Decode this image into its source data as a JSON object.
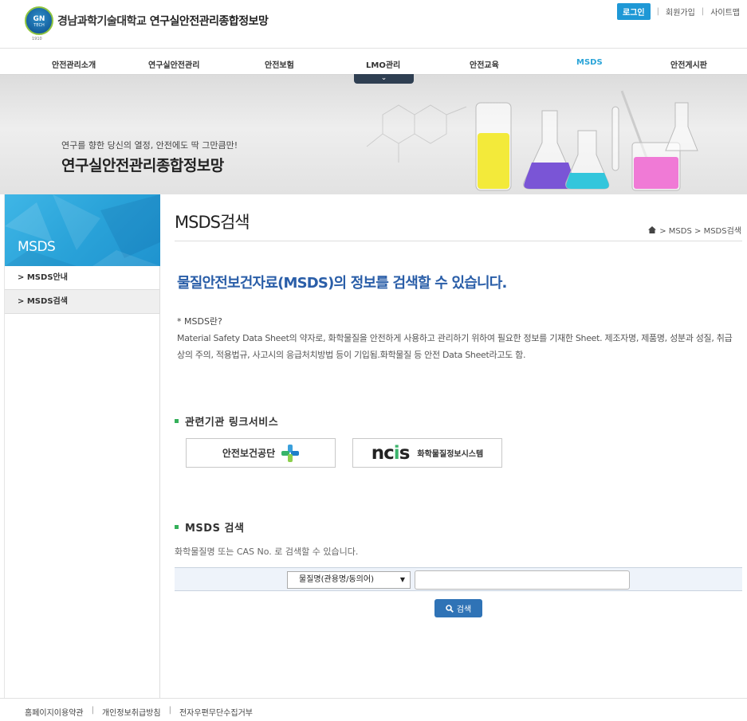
{
  "header": {
    "logo_text": "GN",
    "logo_sub": "TECH",
    "logo_year": "1910",
    "university": "경남과학기술대학교",
    "site_name": "연구실안전관리종합정보망",
    "top_links": {
      "login": "로그인",
      "signup": "회원가입",
      "sitemap": "사이트맵",
      "sep": "|"
    }
  },
  "gnb": {
    "items": [
      "안전관리소개",
      "연구실안전관리",
      "안전보험",
      "LMO관리",
      "안전교육",
      "MSDS",
      "안전게시판"
    ],
    "active": "MSDS",
    "toggle_glyph": "⌄"
  },
  "visual": {
    "slogan": "연구를 향한 당신의 열정, 안전에도 딱 그만큼만!",
    "title": "연구실안전관리종합정보망"
  },
  "lnb": {
    "title": "MSDS",
    "items": [
      "> MSDS안내",
      "> MSDS검색"
    ],
    "active_index": 1
  },
  "content": {
    "page_title": "MSDS검색",
    "breadcrumb": "> MSDS > MSDS검색",
    "intro_heading": "물질안전보건자료(MSDS)의 정보를 검색할 수 있습니다.",
    "definition_label": "* MSDS란?",
    "definition_body": "Material Safety Data Sheet의 약자로, 화학물질을 안전하게 사용하고 관리하기 위하여 필요한 정보를 기재한 Sheet. 제조자명, 제품명, 성분과 성질, 취급상의 주의, 적용법규, 사고시의 응급처치방법 등이 기입됨.화학물질 등 안전 Data Sheet라고도 함.",
    "links_heading": "관련기관 링크서비스",
    "link_kosha": "안전보건공단",
    "link_ncis_logo": "ncis",
    "link_ncis": "화학물질정보시스템",
    "search_heading": "MSDS 검색",
    "search_help": "화학물질명 또는 CAS No. 로 검색할 수 있습니다.",
    "search_select": "물질명(관용명/동의어)",
    "search_input_value": "",
    "search_button": "검색"
  },
  "footer": {
    "links": [
      "홈페이지이용약관",
      "개인정보취급방침",
      "전자우편무단수집거부"
    ],
    "sep": "|"
  },
  "colors": {
    "accent": "#2aa4d8",
    "lnb_head": "#2aa3d9",
    "intro_heading": "#2a5ea8",
    "bullet": "#35b05a",
    "search_button": "#2f73b6",
    "login_button": "#1e98d6"
  }
}
